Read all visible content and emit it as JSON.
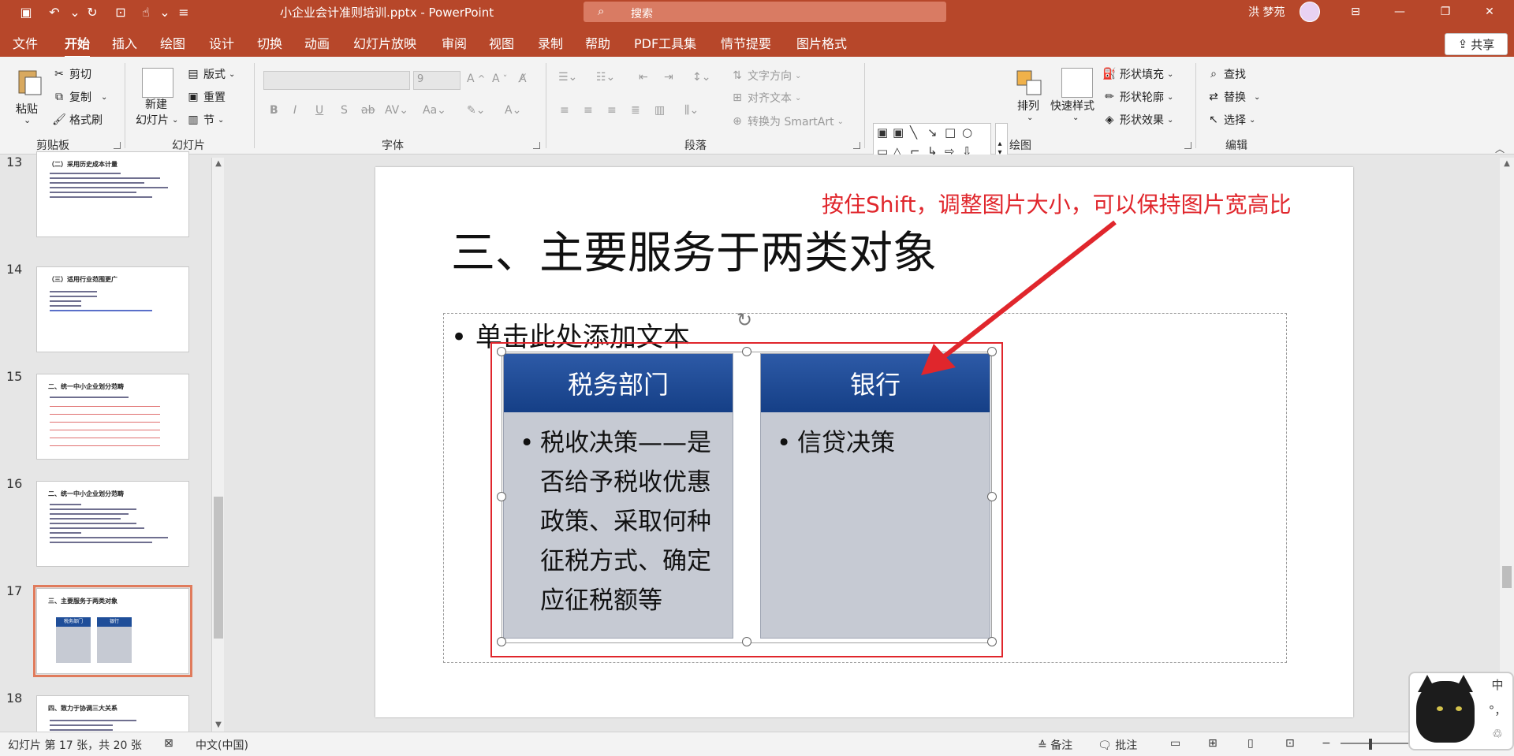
{
  "titlebar": {
    "doc_title": "小企业会计准则培训.pptx  -  PowerPoint",
    "search_placeholder": "搜索",
    "user_name": "洪 梦苑"
  },
  "tabs": [
    "文件",
    "开始",
    "插入",
    "绘图",
    "设计",
    "切换",
    "动画",
    "幻灯片放映",
    "审阅",
    "视图",
    "录制",
    "帮助",
    "PDF工具集",
    "情节提要",
    "图片格式"
  ],
  "share_label": "共享",
  "ribbon": {
    "clipboard": {
      "paste": "粘贴",
      "cut": "剪切",
      "copy": "复制",
      "format_painter": "格式刷",
      "label": "剪贴板"
    },
    "slides": {
      "new_slide": "新建",
      "new_slide2": "幻灯片",
      "layout": "版式",
      "reset": "重置",
      "section": "节",
      "label": "幻灯片"
    },
    "font": {
      "size": "9",
      "label": "字体"
    },
    "paragraph": {
      "text_direction": "文字方向",
      "align_text": "对齐文本",
      "smartart": "转换为 SmartArt",
      "label": "段落"
    },
    "drawing": {
      "arrange": "排列",
      "quick_styles": "快速样式",
      "shape_fill": "形状填充",
      "shape_outline": "形状轮廓",
      "shape_effects": "形状效果",
      "label": "绘图"
    },
    "editing": {
      "find": "查找",
      "replace": "替换",
      "select": "选择",
      "label": "编辑"
    }
  },
  "thumbnails": [
    {
      "num": "13",
      "title": "（二）采用历史成本计量"
    },
    {
      "num": "14",
      "title": "（三）适用行业范围更广"
    },
    {
      "num": "15",
      "title": "二、统一中小企业划分范畴"
    },
    {
      "num": "16",
      "title": "二、统一中小企业划分范畴"
    },
    {
      "num": "17",
      "title": "三、主要服务于两类对象",
      "col1": "税务部门",
      "col2": "银行"
    },
    {
      "num": "18",
      "title": "四、致力于协调三大关系"
    }
  ],
  "slide": {
    "title": "三、主要服务于两类对象",
    "placeholder": "单击此处添加文本",
    "col1_header": "税务部门",
    "col1_body": "税收决策——是否给予税收优惠政策、采取何种征税方式、确定应征税额等",
    "col2_header": "银行",
    "col2_body": "信贷决策",
    "annotation": "按住Shift，调整图片大小，可以保持图片宽高比"
  },
  "statusbar": {
    "slide_info": "幻灯片 第 17 张，共 20 张",
    "language": "中文(中国)",
    "notes": "备注",
    "comments": "批注"
  },
  "ime": {
    "mode": "中",
    "punct": "°，",
    "skin": "♲"
  },
  "colors": {
    "accent": "#b7472a",
    "annotation_red": "#e0262c",
    "header_blue": "#1f4e99"
  }
}
